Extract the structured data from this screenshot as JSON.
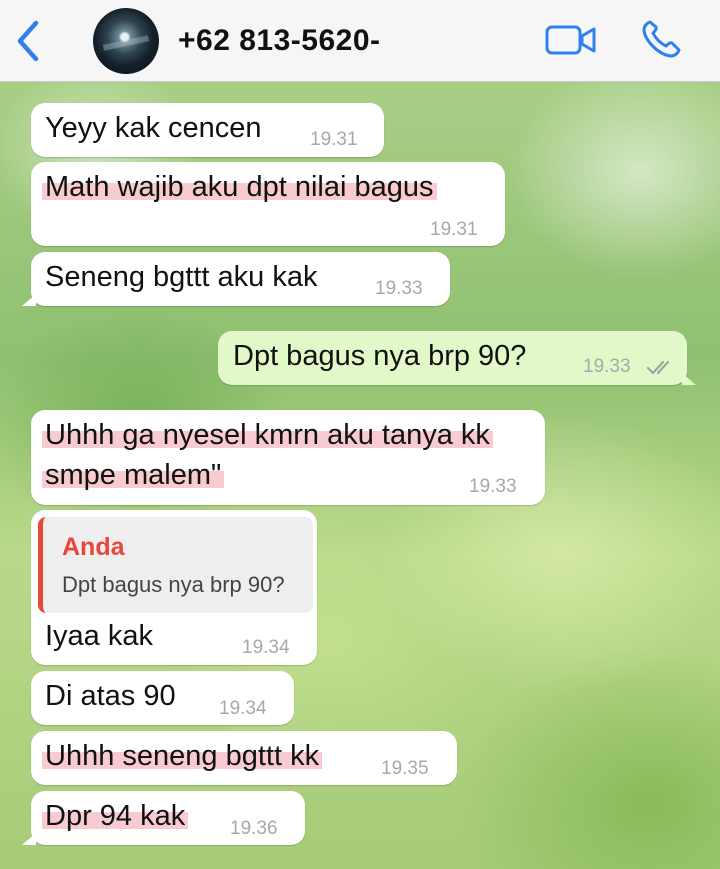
{
  "header": {
    "contact_name": "+62 813-5620-",
    "icons": {
      "back": "chevron-left-icon",
      "video": "video-camera-icon",
      "call": "phone-icon"
    },
    "accent_color": "#2f80ed"
  },
  "messages": [
    {
      "text": "Yeyy kak cencen",
      "time": "19.31",
      "direction": "incoming"
    },
    {
      "text": "Math wajib aku dpt nilai bagus",
      "time": "19.31",
      "direction": "incoming",
      "highlighted": true
    },
    {
      "text": "Seneng bgttt aku kak",
      "time": "19.33",
      "direction": "incoming"
    },
    {
      "text": "Dpt bagus nya brp 90?",
      "time": "19.33",
      "direction": "outgoing",
      "status": "read"
    },
    {
      "lines": [
        "Uhhh ga nyesel kmrn aku tanya kk",
        "smpe malem\""
      ],
      "time": "19.33",
      "direction": "incoming",
      "highlighted": true
    },
    {
      "quote": {
        "author": "Anda",
        "text": "Dpt bagus nya brp 90?"
      },
      "text": "Iyaa kak",
      "time": "19.34",
      "direction": "incoming"
    },
    {
      "text": "Di atas 90",
      "time": "19.34",
      "direction": "incoming"
    },
    {
      "text": "Uhhh seneng bgttt kk",
      "time": "19.35",
      "direction": "incoming",
      "highlighted": true
    },
    {
      "text": "Dpr 94 kak",
      "time": "19.36",
      "direction": "incoming",
      "highlighted": true
    }
  ],
  "colors": {
    "incoming_bubble": "#ffffff",
    "outgoing_bubble": "#e3f8c9",
    "quote_accent": "#e8463b",
    "highlight": "#f0a0aa"
  }
}
